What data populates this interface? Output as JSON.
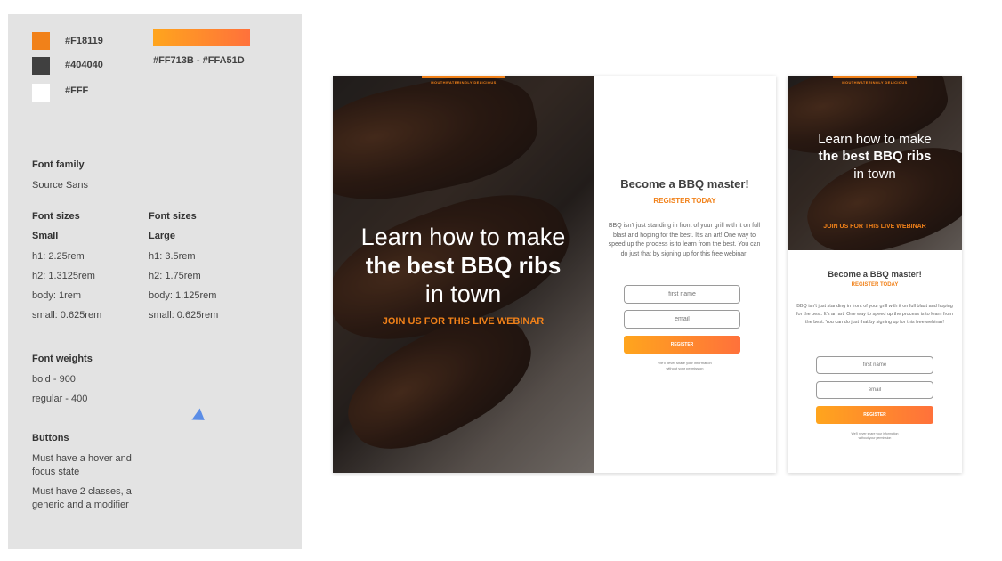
{
  "colors": {
    "orange": "#F18119",
    "dark": "#404040",
    "white": "#FFF",
    "gradient_start": "#FF713B",
    "gradient_end": "#FFA51D"
  },
  "guide": {
    "swatches": [
      {
        "label": "#F18119",
        "color": "#F18119"
      },
      {
        "label": "#404040",
        "color": "#404040"
      },
      {
        "label": "#FFF",
        "color": "#FFFFFF"
      }
    ],
    "gradient_label": "#FF713B - #FFA51D",
    "font_family_title": "Font family",
    "font_family_value": "Source Sans",
    "sizes_small_title": "Font sizes",
    "sizes_small_sub": "Small",
    "sizes_small": [
      "h1: 2.25rem",
      "h2: 1.3125rem",
      "body: 1rem",
      "small: 0.625rem"
    ],
    "sizes_large_title": "Font sizes",
    "sizes_large_sub": "Large",
    "sizes_large": [
      "h1: 3.5rem",
      "h2: 1.75rem",
      "body: 1.125rem",
      "small: 0.625rem"
    ],
    "weights_title": "Font weights",
    "weights": [
      "bold - 900",
      "regular - 400"
    ],
    "buttons_title": "Buttons",
    "buttons_notes": [
      "Must have a hover and focus state",
      "Must have 2 classes, a generic and a modifier"
    ]
  },
  "page": {
    "tagline": "MOUTHWATERINGLY DELICIOUS",
    "hero_line1": "Learn how to make",
    "hero_line2": "the best BBQ ribs",
    "hero_line3": "in town",
    "hero_cta": "JOIN US FOR THIS LIVE WEBINAR",
    "form_title": "Become a BBQ master!",
    "form_subtitle": "REGISTER TODAY",
    "form_body": "BBQ isn't just standing in front of your grill with it on full blast and hoping for the best. It's an art! One way to speed up the process is to learn from the best. You can do just that by signing up for this free webinar!",
    "first_name_placeholder": "first name",
    "email_placeholder": "email",
    "register_label": "REGISTER",
    "fine_print_1": "We'll never share your information",
    "fine_print_2": "without your permission"
  }
}
